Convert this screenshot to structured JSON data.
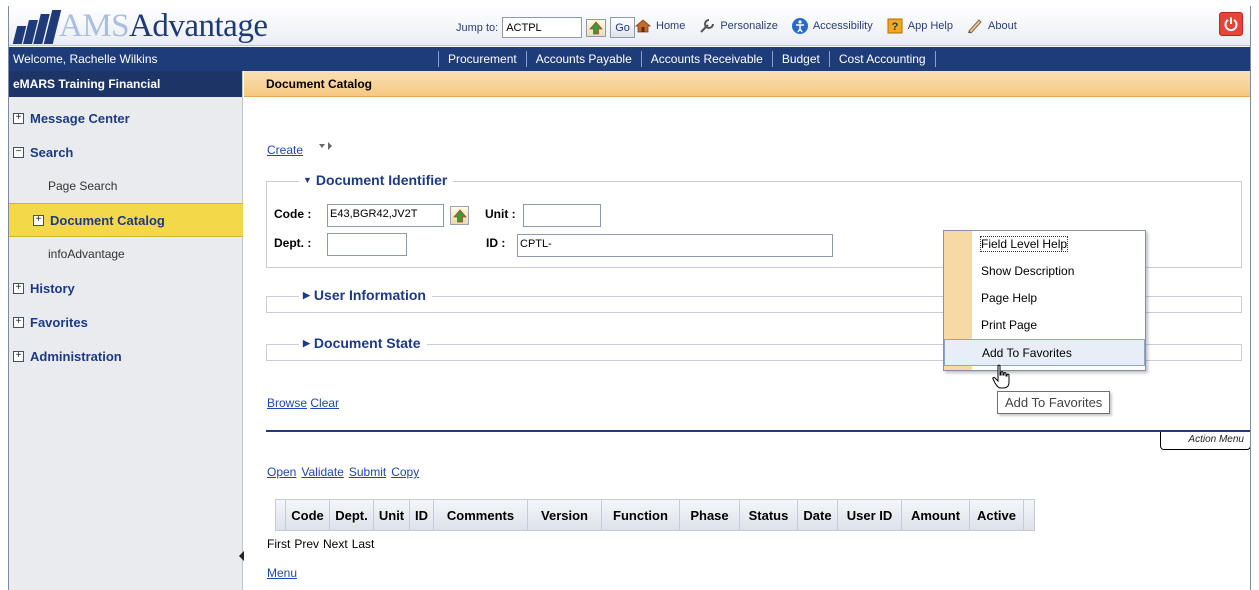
{
  "header": {
    "logo_prefix": "AMS",
    "logo_suffix": "Advantage",
    "jump_label": "Jump to:",
    "jump_value": "ACTPL",
    "go_label": "Go",
    "links": [
      {
        "label": "Home",
        "icon": "home-icon"
      },
      {
        "label": "Personalize",
        "icon": "wrench-icon"
      },
      {
        "label": "Accessibility",
        "icon": "accessibility-icon"
      },
      {
        "label": "App Help",
        "icon": "help-book-icon"
      },
      {
        "label": "About",
        "icon": "about-icon"
      }
    ]
  },
  "navbar": {
    "welcome": "Welcome, Rachelle Wilkins",
    "tabs": [
      "Procurement",
      "Accounts Payable",
      "Accounts Receivable",
      "Budget",
      "Cost Accounting"
    ]
  },
  "sidebar": {
    "title": "eMARS Training Financial",
    "items": {
      "message_center": "Message Center",
      "search": "Search",
      "page_search": "Page Search",
      "document_catalog": "Document Catalog",
      "info_advantage": "infoAdvantage",
      "history": "History",
      "favorites": "Favorites",
      "administration": "Administration"
    }
  },
  "main": {
    "page_title": "Document Catalog",
    "create_link": "Create",
    "sections": {
      "document_identifier": "Document Identifier",
      "user_information": "User Information",
      "document_state": "Document State"
    },
    "fields": {
      "code_label": "Code :",
      "code_value": "E43,BGR42,JV2T",
      "unit_label": "Unit :",
      "unit_value": "",
      "dept_label": "Dept. :",
      "dept_value": "",
      "id_label": "ID :",
      "id_value": "CPTL-"
    },
    "browse_label": "Browse",
    "clear_label": "Clear",
    "action_menu_label": "Action Menu",
    "actions": [
      "Open",
      "Validate",
      "Submit",
      "Copy"
    ],
    "columns": [
      "Code",
      "Dept.",
      "Unit",
      "ID",
      "Comments",
      "Version",
      "Function",
      "Phase",
      "Status",
      "Date",
      "User ID",
      "Amount",
      "Active"
    ],
    "paging": [
      "First",
      "Prev",
      "Next",
      "Last"
    ],
    "menu_link": "Menu"
  },
  "context_menu": {
    "items": [
      "Field Level Help",
      "Show Description",
      "Page Help",
      "Print Page",
      "Add To Favorites"
    ],
    "tooltip": "Add To Favorites"
  },
  "colors": {
    "nav_blue": "#1f3c7a",
    "highlight_yellow": "#f3d94a",
    "page_bar_orange": "#f7c982",
    "link_blue": "#1d48b0"
  }
}
